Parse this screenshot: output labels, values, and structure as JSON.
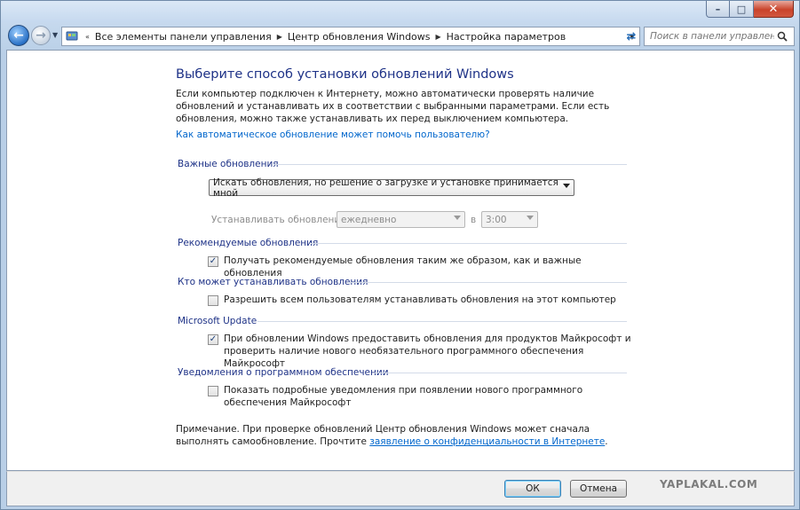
{
  "window": {
    "minimize": "–",
    "maximize": "□",
    "close": "✕"
  },
  "navbar": {
    "breadcrumb": [
      "Все элементы панели управления",
      "Центр обновления Windows",
      "Настройка параметров"
    ],
    "search_placeholder": "Поиск в панели управления"
  },
  "page": {
    "heading": "Выберите способ установки обновлений Windows",
    "intro": "Если компьютер подключен к Интернету, можно автоматически проверять наличие обновлений и устанавливать их в соответствии с выбранными параметрами. Если есть обновления, можно также устанавливать их перед выключением компьютера.",
    "help_link": "Как автоматическое обновление может помочь пользователю?"
  },
  "important_updates": {
    "title": "Важные обновления",
    "mode_selected": "Искать обновления, но решение о загрузке и установке принимается мной",
    "install_label": "Устанавливать обновления:",
    "frequency": "ежедневно",
    "at_label": "в",
    "time": "3:00"
  },
  "recommended_updates": {
    "title": "Рекомендуемые обновления",
    "option_text": "Получать рекомендуемые обновления таким же образом, как и важные обновления",
    "checked": true
  },
  "who_can_install": {
    "title": "Кто может устанавливать обновления",
    "option_text": "Разрешить всем пользователям устанавливать обновления на этот компьютер",
    "checked": false
  },
  "microsoft_update": {
    "title": "Microsoft Update",
    "option_text": "При обновлении Windows предоставить обновления для продуктов Майкрософт и проверить наличие нового необязательного программного обеспечения Майкрософт",
    "checked": true
  },
  "software_notifications": {
    "title": "Уведомления о программном обеспечении",
    "option_text": "Показать подробные уведомления при появлении нового программного обеспечения Майкрософт",
    "checked": false
  },
  "note": {
    "text": "Примечание. При проверке обновлений Центр обновления Windows может сначала выполнять самообновление. Прочтите ",
    "link": "заявление о конфиденциальности в Интернете",
    "suffix": "."
  },
  "footer": {
    "ok_label": "ОК",
    "cancel_label": "Отмена",
    "watermark": "YAPLAKAL.COM"
  },
  "colors": {
    "heading": "#1e3287",
    "link": "#0066cc",
    "close_button": "#c9432b"
  }
}
